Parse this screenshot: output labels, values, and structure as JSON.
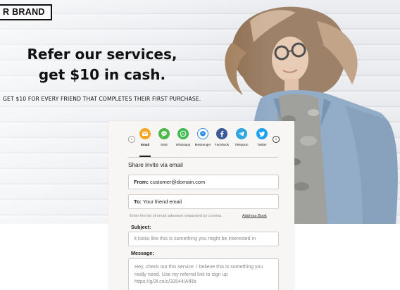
{
  "brand": {
    "label": "R BRAND"
  },
  "hero": {
    "headline_line1": "Refer our services,",
    "headline_line2": "get $10 in cash.",
    "subline": "GET $10 FOR EVERY FRIEND THAT COMPLETES THEIR FIRST PURCHASE."
  },
  "channels": {
    "prev_icon": "chevron-left-icon",
    "next_icon": "chevron-right-icon",
    "active": "Email",
    "items": [
      {
        "label": "Email",
        "icon": "envelope-icon",
        "color": "#f6a623"
      },
      {
        "label": "SMS",
        "icon": "chat-bubble-icon",
        "color": "#4cb84a"
      },
      {
        "label": "Whatsapp",
        "icon": "whatsapp-icon",
        "color": "#3fba50"
      },
      {
        "label": "Messenger",
        "icon": "messenger-icon",
        "color": "#2f8ce6"
      },
      {
        "label": "Facebook",
        "icon": "facebook-icon",
        "color": "#3b5a98"
      },
      {
        "label": "Telegram",
        "icon": "telegram-icon",
        "color": "#2ea6df"
      },
      {
        "label": "Twitter",
        "icon": "twitter-icon",
        "color": "#1da1f2"
      }
    ]
  },
  "form": {
    "title": "Share invite via email",
    "from_label": "From:",
    "from_value": "customer@domain.com",
    "to_label": "To:",
    "to_placeholder": "Your friend email",
    "hint": "Enter the list of email adresses separated by comma",
    "address_book": "Address Book",
    "subject_label": "Subject:",
    "subject_placeholder": "It looks like this is something you might be interested in",
    "message_label": "Message:",
    "message_text": "Hey, check out this service. I believe this is something you really need. Use my referral link to sign up https://g/3f.co/c/33544/AfRb"
  }
}
